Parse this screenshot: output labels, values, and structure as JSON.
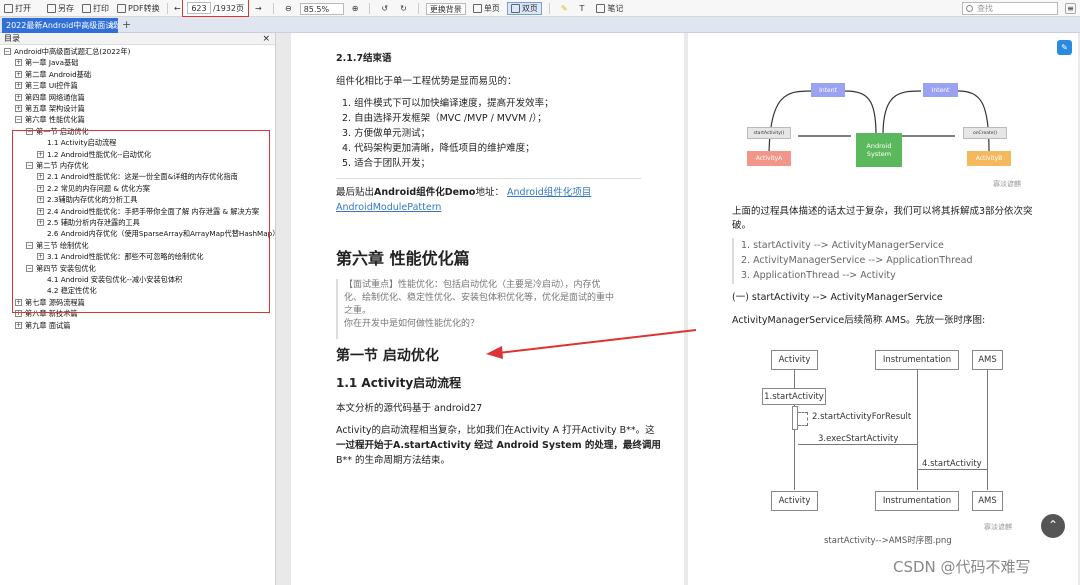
{
  "toolbar": {
    "open": "打开",
    "save_as": "另存",
    "print_preview": "打印",
    "pdf_convert": "PDF转换",
    "page_current": "623",
    "page_total": "/1932页",
    "zoom": "85.5%",
    "background": "更换背景",
    "single_page": "单页",
    "double_page": "双页",
    "note": "笔记",
    "search_placeholder": "查找"
  },
  "tab": {
    "title": "2022最新Android中高级面试题",
    "close": "×",
    "add": "+"
  },
  "sidebar": {
    "header": "目录",
    "close": "×",
    "items": [
      {
        "text": "Android中高级面试题汇总(2022年)",
        "exp": "−"
      },
      {
        "text": "第一章 Java基础",
        "exp": "+"
      },
      {
        "text": "第二章 Android基础",
        "exp": "+"
      },
      {
        "text": "第三章 UI控件篇",
        "exp": "+"
      },
      {
        "text": "第四章 网络通信篇",
        "exp": "+"
      },
      {
        "text": "第五章 架构设计篇",
        "exp": "+"
      },
      {
        "text": "第六章 性能优化篇",
        "exp": "−"
      },
      {
        "text": "第一节 启动优化",
        "exp": "−"
      },
      {
        "text": "1.1 Activity启动流程",
        "exp": ""
      },
      {
        "text": "1.2 Android性能优化--启动优化",
        "exp": "+"
      },
      {
        "text": "第二节 内存优化",
        "exp": "−"
      },
      {
        "text": "2.1 Android性能优化：这是一份全面&详细的内存优化指南",
        "exp": "+"
      },
      {
        "text": "2.2 常见的内存问题 & 优化方案",
        "exp": "+"
      },
      {
        "text": "2.3辅助内存优化的分析工具",
        "exp": "+"
      },
      {
        "text": "2.4 Android性能优化：手把手带你全面了解 内存泄露 & 解决方案",
        "exp": "+"
      },
      {
        "text": "2.5 辅助分析内存泄露的工具",
        "exp": "+"
      },
      {
        "text": "2.6 Android内存优化（使用SparseArray和ArrayMap代替HashMap）",
        "exp": ""
      },
      {
        "text": "第三节 绘制优化",
        "exp": "−"
      },
      {
        "text": "3.1 Android性能优化：那些不可忽略的绘制优化",
        "exp": "+"
      },
      {
        "text": "第四节 安装包优化",
        "exp": "−"
      },
      {
        "text": "4.1 Android 安装包优化--减小安装包体积",
        "exp": ""
      },
      {
        "text": "4.2 稳定性优化",
        "exp": ""
      },
      {
        "text": "第七章 源码流程篇",
        "exp": "+"
      },
      {
        "text": "第八章 新技术篇",
        "exp": "+"
      },
      {
        "text": "第九章 面试篇",
        "exp": "+"
      }
    ]
  },
  "left_page": {
    "h_conclusion": "2.1.7结束语",
    "intro": "组件化相比于单一工程优势是显而易见的：",
    "list": [
      "1. 组件模式下可以加快编译速度，提高开发效率；",
      "2. 自由选择开发框架（MVC /MVP / MVVM /）；",
      "3. 方便做单元测试；",
      "4. 代码架构更加清晰，降低项目的维护难度；",
      "5. 适合于团队开发；"
    ],
    "demo_prefix": "最后贴出",
    "demo_bold": "Android组件化Demo",
    "demo_mid": "地址：",
    "demo_link1": "Android组件化项目",
    "demo_link2": "AndroidModulePattern",
    "chapter": "第六章 性能优化篇",
    "quote": [
      "【面试重点】性能优化：包括启动优化（主要是冷启动），内存优",
      "化、绘制优化、稳定性优化、安装包体积优化等，优化是面试的重中",
      "之重。",
      "你在开发中是如何做性能优化的？"
    ],
    "section": "第一节 启动优化",
    "subsection": "1.1 Activity启动流程",
    "source_note": "本文分析的源代码基于 android27",
    "para": [
      "Activity的启动流程相当复杂，比如我们在Activity A 打开Activity B**。这",
      "一过程开始于A.startActivity 经过 Android System 的处理，最终调用",
      "B** 的生命周期方法结束。"
    ]
  },
  "right_page": {
    "top_diagram": {
      "intent1": "Intent",
      "intent2": "Intent",
      "box1": "startActivity()",
      "box2": "onCreate()",
      "activity_a": "ActivityA",
      "android_system": [
        "Android",
        "System"
      ],
      "activity_b": "ActivityB",
      "watermark": "寡淡谚麒"
    },
    "explain": [
      "上面的过程具体描述的话太过于复杂，我们可以将其拆解成3部分依次突",
      "破。"
    ],
    "steps": [
      "1. startActivity --> ActivityManagerService",
      "2. ActivityManagerService --> ApplicationThread",
      "3. ApplicationThread --> Activity"
    ],
    "part1": "(一) startActivity --> ActivityManagerService",
    "ams_note": "ActivityManagerService后续简称 AMS。先放一张时序图:",
    "seq": {
      "col_activity": "Activity",
      "col_instr": "Instrumentation",
      "col_ams": "AMS",
      "m1": "1.startActivity",
      "m2": "2.startActivityForResult",
      "m3": "3.execStartActivity",
      "m4": "4.startActivity",
      "caption": "startActivity-->AMS时序图.png",
      "watermark": "寡淡谚麒"
    }
  },
  "csdn_watermark": "CSDN @代码不难写",
  "colors": {
    "accent_blue": "#2f6fd6",
    "highlight_red": "#d33333",
    "link_blue": "#3478c6",
    "intent_purple": "#9aa2f2",
    "activity_a_red": "#f2968a",
    "system_green": "#5cb85c",
    "activity_b_orange": "#f5b95d"
  }
}
